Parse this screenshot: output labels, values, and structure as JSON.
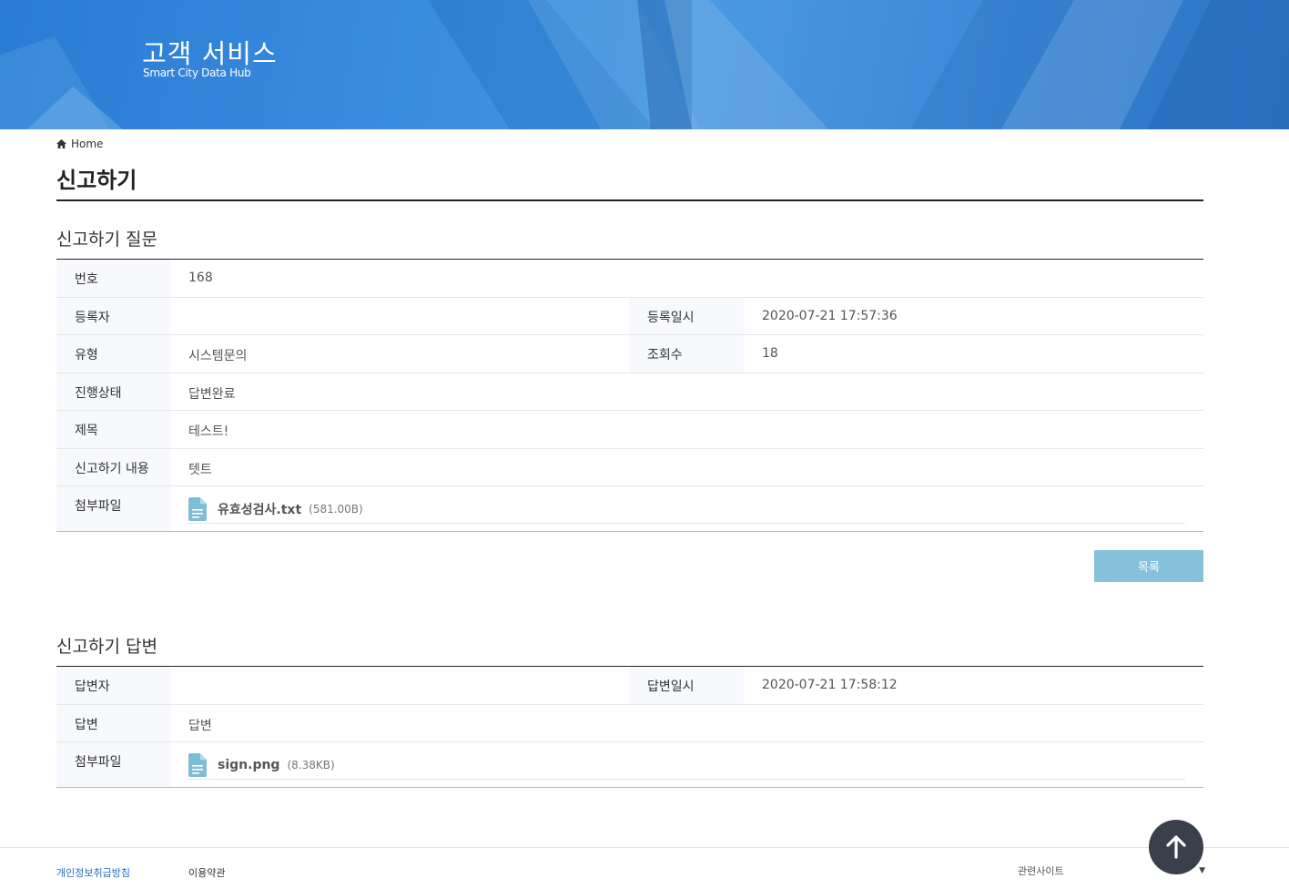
{
  "banner": {
    "title": "고객 서비스",
    "subtitle": "Smart City Data Hub"
  },
  "breadcrumb": {
    "home_label": "Home"
  },
  "page_title": "신고하기",
  "question": {
    "section_title": "신고하기 질문",
    "labels": {
      "number": "번호",
      "registrant": "등록자",
      "reg_date": "등록일시",
      "type": "유형",
      "views": "조회수",
      "status": "진행상태",
      "subject": "제목",
      "content": "신고하기 내용",
      "attachment": "첨부파일"
    },
    "values": {
      "number": "168",
      "registrant": "",
      "reg_date": "2020-07-21 17:57:36",
      "type": "시스템문의",
      "views": "18",
      "status": "답변완료",
      "subject": "테스트!",
      "content": "텟트"
    },
    "file": {
      "name": "유효성검사.txt",
      "size": "(581.00B)",
      "icon": "document-icon"
    }
  },
  "list_button": "목록",
  "answer": {
    "section_title": "신고하기 답변",
    "labels": {
      "answerer": "답변자",
      "answer_date": "답변일시",
      "answer": "답변",
      "attachment": "첨부파일"
    },
    "values": {
      "answerer": "",
      "answer_date": "2020-07-21 17:58:12",
      "answer": "답변"
    },
    "file": {
      "name": "sign.png",
      "size": "(8.38KB)",
      "icon": "document-icon"
    }
  },
  "footer": {
    "privacy": "개인정보취급방침",
    "terms": "이용약관",
    "related_sites": "관련사이트"
  },
  "colors": {
    "banner": "#3a8ddf",
    "list_button": "#86c1da",
    "top_button": "#3a3f4b",
    "file_icon": "#7fbcd6"
  }
}
